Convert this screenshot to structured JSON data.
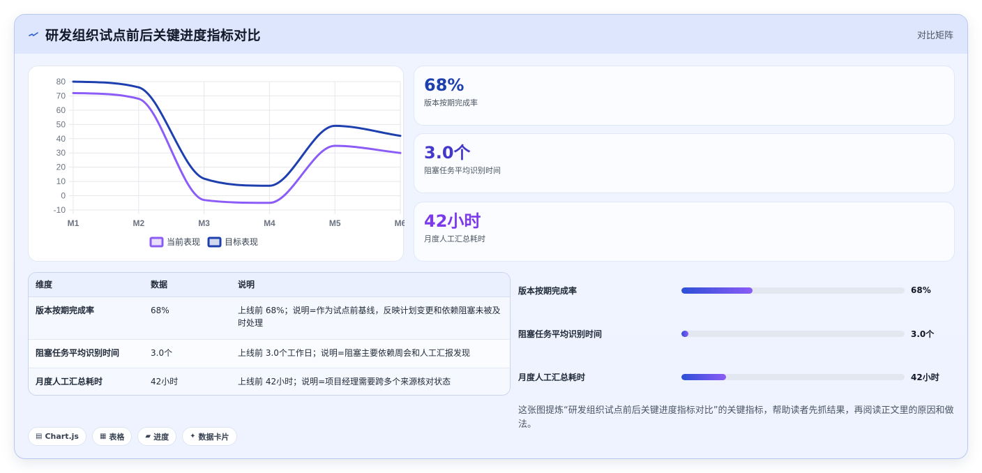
{
  "header": {
    "title": "研发组织试点前后关键进度指标对比",
    "tag": "对比矩阵",
    "icon": "pulse-icon"
  },
  "colors": {
    "current": "#8b5cf6",
    "target": "#1e40af",
    "metric_1": "#1e40af",
    "metric_2": "#4338ca",
    "metric_3": "#7c3aed"
  },
  "chart_data": {
    "type": "line",
    "categories": [
      "M1",
      "M2",
      "M3",
      "M4",
      "M5",
      "M6"
    ],
    "ylim": [
      -10,
      80
    ],
    "yticks": [
      -10,
      0,
      10,
      20,
      30,
      40,
      50,
      60,
      70,
      80
    ],
    "grid": true,
    "legend_position": "bottom",
    "smooth": true,
    "series": [
      {
        "name": "当前表现",
        "values": [
          72,
          68,
          -3,
          -5,
          35,
          30
        ],
        "color": "#8b5cf6"
      },
      {
        "name": "目标表现",
        "values": [
          80,
          76,
          12,
          7,
          49,
          42
        ],
        "color": "#1e40af"
      }
    ]
  },
  "metrics": [
    {
      "value": "68%",
      "label": "版本按期完成率"
    },
    {
      "value": "3.0个",
      "label": "阻塞任务平均识别时间"
    },
    {
      "value": "42小时",
      "label": "月度人工汇总耗时"
    }
  ],
  "table": {
    "headers": [
      "维度",
      "数据",
      "说明"
    ],
    "rows": [
      {
        "dimension": "版本按期完成率",
        "data": "68%",
        "note": "上线前 68%；说明=作为试点前基线，反映计划变更和依赖阻塞未被及时处理"
      },
      {
        "dimension": "阻塞任务平均识别时间",
        "data": "3.0个",
        "note": "上线前 3.0个工作日；说明=阻塞主要依赖周会和人工汇报发现"
      },
      {
        "dimension": "月度人工汇总耗时",
        "data": "42小时",
        "note": "上线前 42小时；说明=项目经理需要跨多个来源核对状态"
      }
    ]
  },
  "progress": [
    {
      "label": "版本按期完成率",
      "value": "68%",
      "fraction": 0.32
    },
    {
      "label": "阻塞任务平均识别时间",
      "value": "3.0个",
      "fraction": 0.03
    },
    {
      "label": "月度人工汇总耗时",
      "value": "42小时",
      "fraction": 0.2
    }
  ],
  "summary": "这张图提炼“研发组织试点前后关键进度指标对比”的关键指标，帮助读者先抓结果，再阅读正文里的原因和做法。",
  "chips": [
    {
      "icon": "▤",
      "label": "Chart.js"
    },
    {
      "icon": "▦",
      "label": "表格"
    },
    {
      "icon": "▰",
      "label": "进度"
    },
    {
      "icon": "✦",
      "label": "数据卡片"
    }
  ]
}
